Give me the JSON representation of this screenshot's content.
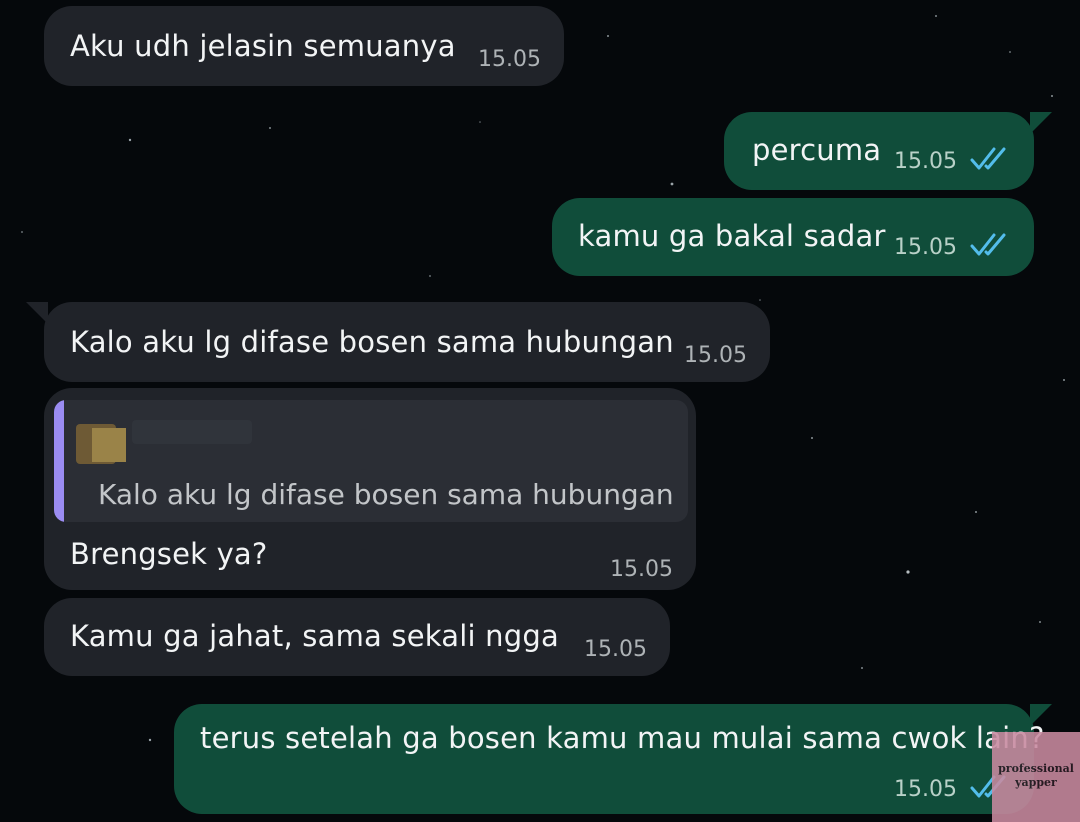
{
  "chat": {
    "messages": [
      {
        "direction": "incoming",
        "text": "Aku udh jelasin semuanya",
        "time": "15.05"
      },
      {
        "direction": "outgoing",
        "text": "percuma",
        "time": "15.05",
        "status": "read"
      },
      {
        "direction": "outgoing",
        "text": "kamu ga bakal sadar",
        "time": "15.05",
        "status": "read"
      },
      {
        "direction": "incoming",
        "text": "Kalo aku lg difase bosen sama hubungan",
        "time": "15.05"
      },
      {
        "direction": "incoming",
        "reply_quote": "Kalo aku lg difase bosen sama hubungan",
        "text": "Brengsek ya?",
        "time": "15.05"
      },
      {
        "direction": "incoming",
        "text": "Kamu ga jahat, sama sekali ngga",
        "time": "15.05"
      },
      {
        "direction": "outgoing",
        "text": "terus setelah ga bosen kamu mau mulai sama cwok lain?",
        "time": "15.05",
        "status": "read"
      }
    ]
  },
  "watermark": {
    "line1": "professional",
    "line2": "yapper"
  },
  "colors": {
    "background": "#05080b",
    "incoming_bubble": "#202329",
    "outgoing_bubble": "#104d3a",
    "read_ticks": "#53bdeb",
    "quote_accent": "#9b8cf2"
  },
  "icons": {
    "read_receipt": "double-check-icon"
  }
}
